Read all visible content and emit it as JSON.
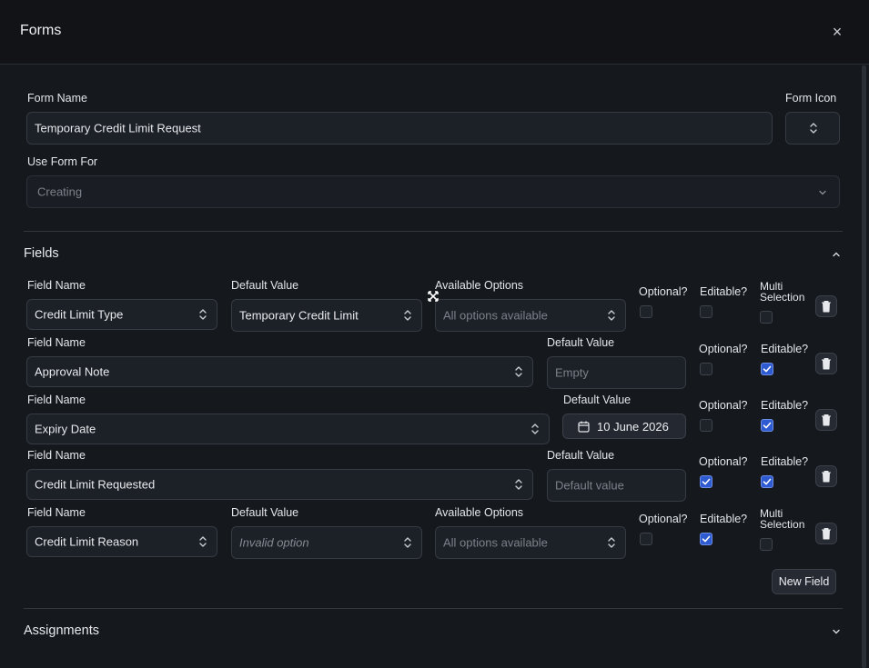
{
  "dialog": {
    "title": "Forms",
    "close_symbol": "×"
  },
  "form": {
    "name_label": "Form Name",
    "name_value": "Temporary Credit Limit Request",
    "icon_label": "Form Icon",
    "use_for_label": "Use Form For",
    "use_for_value": "Creating"
  },
  "fields_section": {
    "title": "Fields",
    "rows": [
      {
        "field_name_label": "Field Name",
        "field_name": "Credit Limit Type",
        "default_label": "Default Value",
        "default_value": "Temporary Credit Limit",
        "options_label": "Available Options",
        "options_value": "All options available",
        "optional_label": "Optional?",
        "optional": false,
        "editable_label": "Editable?",
        "editable": false,
        "multi_label_1": "Multi",
        "multi_label_2": "Selection",
        "multi": false
      },
      {
        "field_name_label": "Field Name",
        "field_name": "Approval Note",
        "default_label": "Default Value",
        "default_placeholder": "Empty",
        "optional_label": "Optional?",
        "optional": false,
        "editable_label": "Editable?",
        "editable": true
      },
      {
        "field_name_label": "Field Name",
        "field_name": "Expiry Date",
        "default_label": "Default Value",
        "default_value": "10 June 2026",
        "optional_label": "Optional?",
        "optional": false,
        "editable_label": "Editable?",
        "editable": true
      },
      {
        "field_name_label": "Field Name",
        "field_name": "Credit Limit Requested",
        "default_label": "Default Value",
        "default_placeholder": "Default value",
        "optional_label": "Optional?",
        "optional": true,
        "editable_label": "Editable?",
        "editable": true
      },
      {
        "field_name_label": "Field Name",
        "field_name": "Credit Limit Reason",
        "default_label": "Default Value",
        "default_value": "Invalid option",
        "options_label": "Available Options",
        "options_value": "All options available",
        "optional_label": "Optional?",
        "optional": false,
        "editable_label": "Editable?",
        "editable": true,
        "multi_label_1": "Multi",
        "multi_label_2": "Selection",
        "multi": false
      }
    ],
    "new_field_label": "New Field"
  },
  "assignments_section": {
    "title": "Assignments"
  },
  "colors": {
    "checkbox_checked": "#2f5bd2",
    "background": "#15181d",
    "header": "#111317"
  },
  "icons": [
    "close-icon",
    "chevron-up-icon",
    "chevron-down-icon",
    "updown-icon",
    "trash-icon",
    "calendar-icon",
    "check-icon"
  ]
}
